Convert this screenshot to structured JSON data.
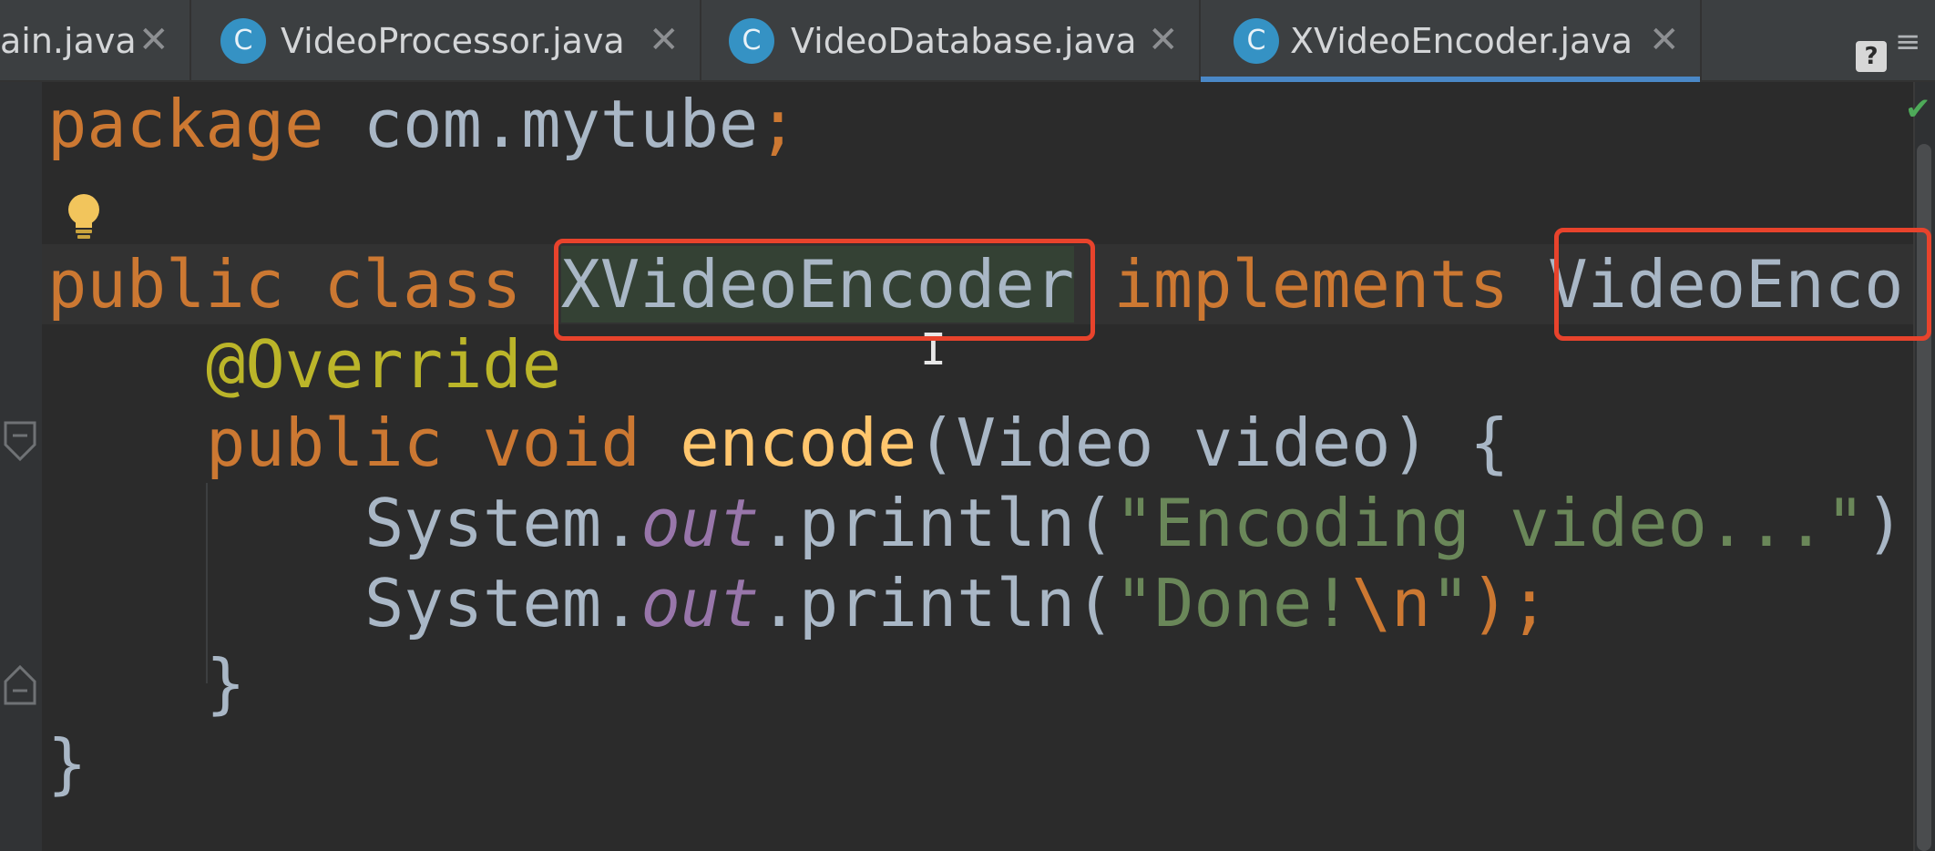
{
  "tabs": [
    {
      "label": "ain.java",
      "icon": "class-icon",
      "active": false
    },
    {
      "label": "VideoProcessor.java",
      "icon": "class-icon",
      "active": false
    },
    {
      "label": "VideoDatabase.java",
      "icon": "class-icon",
      "active": false
    },
    {
      "label": "XVideoEncoder.java",
      "icon": "class-icon",
      "active": true
    }
  ],
  "tab_icon_letter": "C",
  "close_glyph": "✕",
  "help_glyph": "?",
  "code": {
    "line1": {
      "kw": "package",
      "pkg": "com.mytube",
      "semi": ";"
    },
    "line2": {
      "kw1": "public",
      "kw2": "class",
      "name": "XVideoEncoder",
      "kw3": "implements",
      "iface": "VideoEnco"
    },
    "line3": {
      "annotation": "@Override"
    },
    "line4": {
      "kw1": "public",
      "kw2": "void",
      "method": "encode",
      "params": "(Video video) {"
    },
    "line5": {
      "cls": "System.",
      "field": "out",
      "call": ".println(",
      "str": "\"Encoding video...\"",
      "tail": ")"
    },
    "line6": {
      "cls": "System.",
      "field": "out",
      "call": ".println(",
      "str1": "\"Done!",
      "esc": "\\n",
      "str2": "\"",
      "tail": ");"
    },
    "line7": {
      "brace": "}"
    },
    "line8": {
      "brace": "}"
    }
  },
  "colors": {
    "keyword": "#cc7832",
    "identifier": "#a9b7c6",
    "annotation": "#bbb529",
    "method": "#ffc66d",
    "field": "#9876aa",
    "string": "#6a8759",
    "callout": "#e8432c",
    "tab_accent": "#4a88c7"
  }
}
